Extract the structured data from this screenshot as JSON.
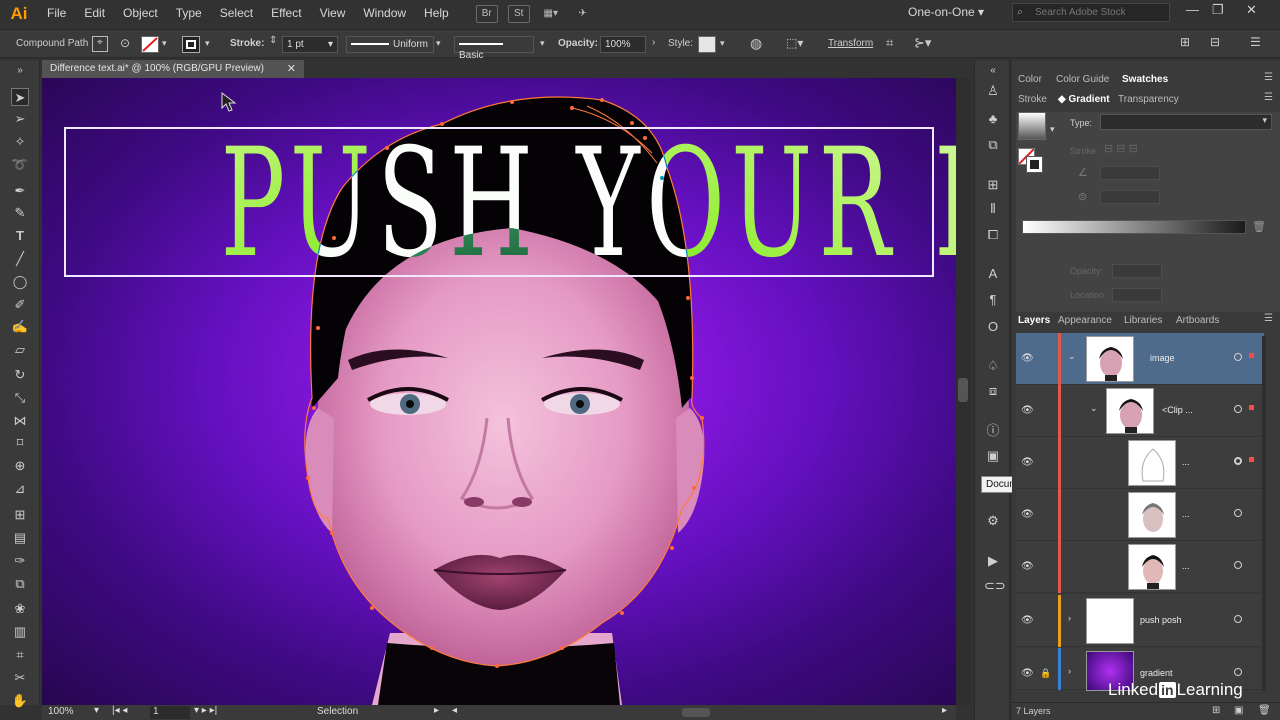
{
  "app": {
    "logo": "Ai"
  },
  "menu": [
    "File",
    "Edit",
    "Object",
    "Type",
    "Select",
    "Effect",
    "View",
    "Window",
    "Help"
  ],
  "menu_icons": [
    "Br",
    "St"
  ],
  "workspace": "One-on-One",
  "stock_search_placeholder": "Search Adobe Stock",
  "control": {
    "selection_type": "Compound Path",
    "stroke_label": "Stroke:",
    "stroke_weight": "1 pt",
    "profile_1": "Uniform",
    "profile_2": "Basic",
    "opacity_label": "Opacity:",
    "opacity_value": "100%",
    "style_label": "Style:",
    "transform_label": "Transform"
  },
  "document_tab": {
    "title": "Difference text.ai* @ 100% (RGB/GPU Preview)"
  },
  "artwork": {
    "headline": "PUSH YOUR POSH"
  },
  "status": {
    "zoom": "100%",
    "artboard": "1",
    "tool": "Selection"
  },
  "tooltip": "Document Info",
  "panels": {
    "top_tabs": [
      "Color",
      "Color Guide",
      "Swatches"
    ],
    "sub_tabs": [
      "Stroke",
      "Gradient",
      "Transparency"
    ],
    "gradient": {
      "type_label": "Type:",
      "stroke_label": "Stroke:",
      "opacity_label": "Opacity:",
      "location_label": "Location:"
    },
    "layer_tabs": [
      "Layers",
      "Appearance",
      "Libraries",
      "Artboards"
    ]
  },
  "layers": {
    "rows": [
      {
        "name": "image"
      },
      {
        "name": "<Clip ..."
      },
      {
        "name": "..."
      },
      {
        "name": "..."
      },
      {
        "name": "..."
      },
      {
        "name": "push posh"
      },
      {
        "name": "gradient"
      }
    ],
    "count": "7 Layers"
  },
  "watermark": {
    "pre": "Linked",
    "in": "in",
    "post": "Learning"
  },
  "colors": {
    "accent_orange": "#ff9a00",
    "selection_blue": "#4e6b8b",
    "layer_red": "#e05a4a",
    "layer_orange": "#e8a020",
    "layer_blue": "#3a7fd8"
  }
}
